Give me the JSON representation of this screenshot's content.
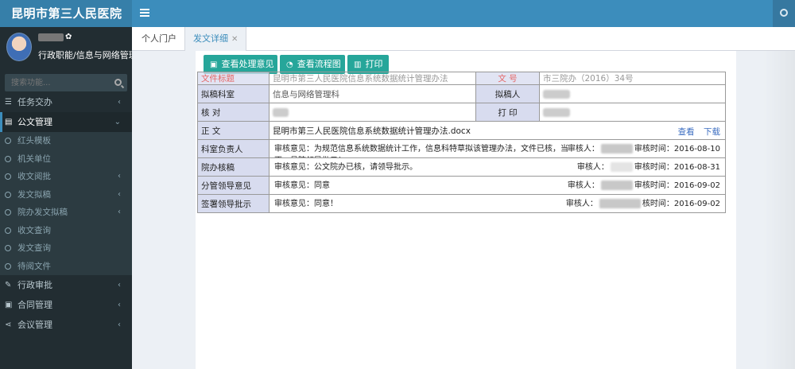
{
  "app": {
    "title": "昆明市第三人民医院"
  },
  "user": {
    "department": "行政职能/信息与网络管理科"
  },
  "sidebar": {
    "search_placeholder": "搜索功能...",
    "items": [
      {
        "label": "任务交办",
        "icon": "list-icon"
      },
      {
        "label": "公文管理",
        "icon": "file-icon"
      }
    ],
    "sub_items": [
      {
        "label": "红头模板"
      },
      {
        "label": "机关单位"
      },
      {
        "label": "收文阅批"
      },
      {
        "label": "发文拟稿"
      },
      {
        "label": "院办发文拟稿"
      },
      {
        "label": "收文查询"
      },
      {
        "label": "发文查询"
      },
      {
        "label": "待阅文件"
      }
    ],
    "bottom_items": [
      {
        "label": "行政审批",
        "icon": "edit-icon"
      },
      {
        "label": "合同管理",
        "icon": "briefcase-icon"
      },
      {
        "label": "会议管理",
        "icon": "share-icon"
      }
    ]
  },
  "tabs": [
    {
      "label": "个人门户"
    },
    {
      "label": "发文详细"
    }
  ],
  "toolbar": {
    "view_process": "查看处理意见",
    "view_flow": "查看流程图",
    "print": "打印"
  },
  "doc": {
    "title_label": "文件标题",
    "title_value": "昆明市第三人民医院信息系统数据统计管理办法",
    "docno_label": "文 号",
    "docno_value": "市三院办（2016）34号",
    "dept_label": "拟稿科室",
    "dept_value": "信息与网络管理科",
    "drafter_label": "拟稿人",
    "check_label": "核 对",
    "print_label": "打 印",
    "body_label": "正 文",
    "body_file": "昆明市第三人民医院信息系统数据统计管理办法.docx",
    "view_link": "查看",
    "download_link": "下载"
  },
  "opinions": [
    {
      "role": "科室负责人",
      "text": "审核意见：为规范信息系统数据统计工作，信息科特草拟该管理办法，文件已核，当否，呈院领导批示！",
      "reviewer_label": "审核人：",
      "time_label": "审核时间：",
      "time": "2016-08-10"
    },
    {
      "role": "院办核稿",
      "text": "审核意见：公文院办已核，请领导批示。",
      "reviewer_label": "审核人：",
      "time_label": "审核时间：",
      "time": "2016-08-31"
    },
    {
      "role": "分管领导意见",
      "text": "审核意见：同意",
      "reviewer_label": "审核人：",
      "time_label": "审核时间：",
      "time": "2016-09-02"
    },
    {
      "role": "签署领导批示",
      "text": "审核意见：同意！",
      "reviewer_label": "审核人：",
      "time_label": "核时间：",
      "time": "2016-09-02"
    }
  ]
}
